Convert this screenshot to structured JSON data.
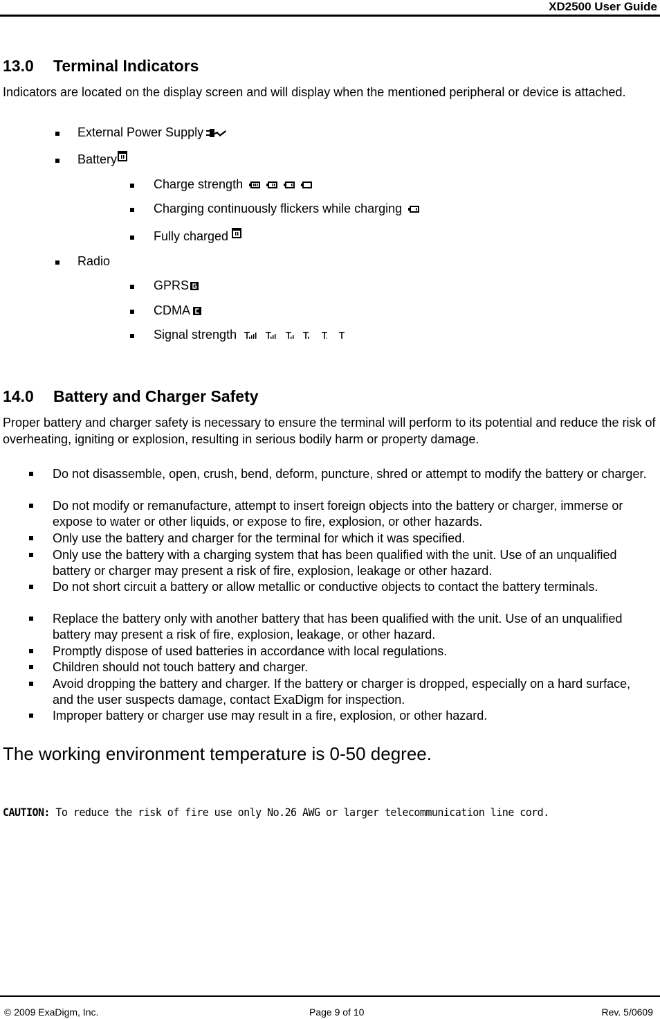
{
  "header": {
    "title": "XD2500 User Guide"
  },
  "section13": {
    "number": "13.0",
    "title": "Terminal Indicators",
    "intro": "Indicators are located on the display screen and will display when the mentioned peripheral or device is attached.",
    "items": [
      {
        "label": "External Power Supply",
        "icon": "power-plug-icon"
      },
      {
        "label": "Battery",
        "icon": "battery-full-icon",
        "subitems": [
          {
            "label": "Charge strength",
            "icons": [
              "battery-3-bars-icon",
              "battery-2-bars-icon",
              "battery-1-bar-icon",
              "battery-empty-icon"
            ]
          },
          {
            "label": "Charging continuously flickers while charging",
            "icons": [
              "battery-charging-icon"
            ]
          },
          {
            "label": "Fully charged",
            "icons": [
              "battery-full-icon"
            ]
          }
        ]
      },
      {
        "label": "Radio",
        "subitems": [
          {
            "label": "GPRS",
            "icons": [
              "gprs-icon"
            ]
          },
          {
            "label": "CDMA",
            "icons": [
              "cdma-icon"
            ]
          },
          {
            "label": "Signal strength",
            "icons": [
              "signal-4-bars-icon",
              "signal-3-bars-icon",
              "signal-2-bars-icon",
              "signal-1-bar-icon",
              "signal-weak-icon",
              "signal-none-icon"
            ]
          }
        ]
      }
    ]
  },
  "section14": {
    "number": "14.0",
    "title": "Battery and Charger Safety",
    "intro": "Proper battery and charger safety is necessary to ensure the terminal will perform to its potential and reduce the risk of overheating, igniting or explosion, resulting in serious bodily harm or property damage.",
    "bullets": [
      "Do not disassemble, open, crush, bend, deform, puncture, shred or attempt to modify the battery or charger.",
      "Do not modify or remanufacture, attempt to insert foreign objects into the battery or charger, immerse or expose to water or other liquids, or expose to fire, explosion, or other hazards.",
      "Only use the battery and charger for the terminal for which it was specified.",
      "Only use the battery with a charging system that has been qualified with the unit. Use of an unqualified battery or charger may present a risk of fire, explosion, leakage or other hazard.",
      "Do not short circuit a battery or allow metallic or conductive objects to contact the battery terminals.",
      "Replace the battery only with another battery that has been qualified with the unit. Use of an unqualified battery may present a risk of fire, explosion, leakage, or other hazard.",
      "Promptly dispose of used batteries in accordance with local regulations.",
      "Children should not touch battery and charger.",
      "Avoid dropping the battery and charger. If the battery or charger is dropped, especially on a hard surface, and the user suspects damage, contact ExaDigm for inspection.",
      "Improper battery or charger use may result in a fire, explosion, or other hazard."
    ]
  },
  "temperature_note": "The working environment temperature is 0-50 degree.",
  "caution": {
    "label": "CAUTION:",
    "text": " To reduce the risk of fire use only No.26 AWG or larger telecommunication line cord."
  },
  "footer": {
    "copyright": "© 2009 ExaDigm, Inc.",
    "page": "Page 9 of 10",
    "revision": "Rev. 5/0609"
  }
}
